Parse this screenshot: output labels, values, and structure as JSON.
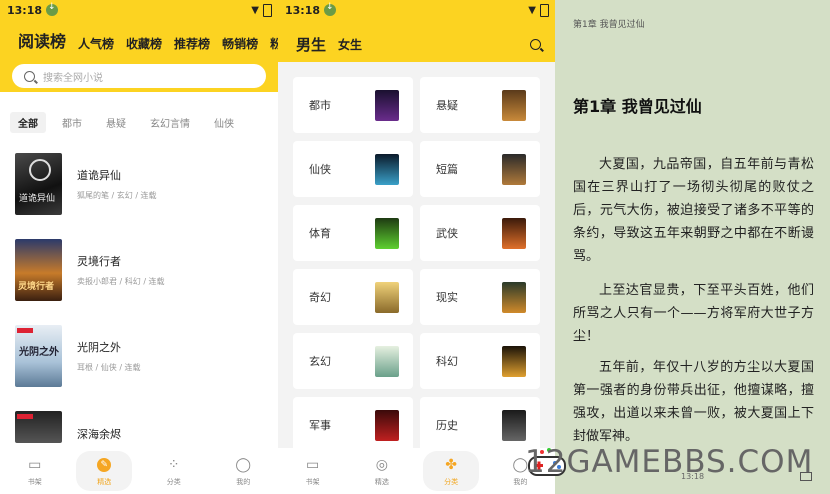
{
  "status": {
    "time": "13:18"
  },
  "panel1": {
    "rank_tabs": [
      "阅读榜",
      "人气榜",
      "收藏榜",
      "推荐榜",
      "畅销榜",
      "粉"
    ],
    "search_placeholder": "搜索全网小说",
    "categories": [
      "全部",
      "都市",
      "悬疑",
      "玄幻言情",
      "仙侠"
    ],
    "books": [
      {
        "title": "道诡异仙",
        "sub": "狐尾的笔 / 玄幻 / 连载"
      },
      {
        "title": "灵境行者",
        "sub": "卖报小郎君 / 科幻 / 连载"
      },
      {
        "title": "光阴之外",
        "sub": "耳根 / 仙侠 / 连载"
      },
      {
        "title": "深海余烬",
        "sub": ""
      }
    ],
    "nav": [
      {
        "label": "书架",
        "icon": "bookshelf-icon"
      },
      {
        "label": "精选",
        "icon": "compass-icon"
      },
      {
        "label": "分类",
        "icon": "category-icon"
      },
      {
        "label": "我的",
        "icon": "user-icon"
      }
    ]
  },
  "panel2": {
    "tabs": [
      "男生",
      "女生"
    ],
    "genres": [
      "都市",
      "悬疑",
      "仙侠",
      "短篇",
      "体育",
      "武侠",
      "奇幻",
      "现实",
      "玄幻",
      "科幻",
      "军事",
      "历史"
    ],
    "nav": [
      {
        "label": "书架",
        "icon": "bookshelf-icon"
      },
      {
        "label": "精选",
        "icon": "compass-icon"
      },
      {
        "label": "分类",
        "icon": "category-icon"
      },
      {
        "label": "我的",
        "icon": "user-icon"
      }
    ]
  },
  "reader": {
    "header": "第1章 我曾见过仙",
    "chapter_title": "第1章 我曾见过仙",
    "paragraphs": [
      "大夏国，九品帝国，自五年前与青松国在三界山打了一场彻头彻尾的败仗之后，元气大伤，被迫接受了诸多不平等的条约，导致这五年来朝野之中都在不断谩骂。",
      "上至达官显贵，下至平头百姓，他们所骂之人只有一个——方将军府大世子方尘！",
      "五年前，年仅十八岁的方尘以大夏国第一强者的身份带兵出征，他擅谋略，擅强攻，出道以来未曾一败，被大夏国上下封做军神。"
    ],
    "time": "13:18"
  },
  "watermark": "12GAMEBBS.COM",
  "colors": {
    "accent": "#fcd321",
    "reader_bg": "#d4dfc6",
    "nav_active": "#f5a623"
  }
}
